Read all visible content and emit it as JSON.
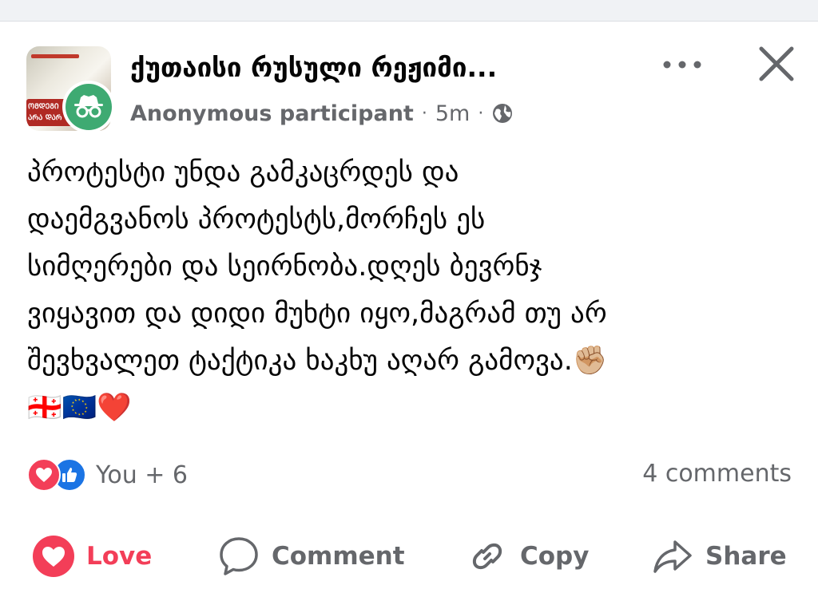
{
  "header": {
    "group_name": "ქუთაისი რუსული რეჟიმი...",
    "author": "Anonymous participant",
    "time": "5m",
    "thumb_badge_lines": [
      "ᲝᲛᲓᲔᲒᲘ",
      "ᲐᲠᲐ ᲓᲐᲠ"
    ]
  },
  "post": {
    "text": "პროტესტი უნდა გამკაცრდეს და\nდაემგვანოს პროტესტს,მორჩეს ეს\nსიმღერები და სეირნობა.დღეს ბევრნჯ\nვიყავით და დიდი მუხტი იყო,მაგრამ თუ არ\nშევხვალეთ ტაქტიკა ხაკხუ აღარ გამოვა.✊🏼\n🇬🇪🇪🇺❤️"
  },
  "reactions": {
    "count_label": "You + 6",
    "comments_label": "4 comments"
  },
  "actions": {
    "love": "Love",
    "comment": "Comment",
    "copy": "Copy",
    "share": "Share"
  },
  "colors": {
    "love": "#f33e58",
    "like": "#1b74e4",
    "anonymous_badge": "#3eaa72",
    "secondary_text": "#65676b"
  },
  "icons": [
    "anonymous-icon",
    "globe-icon",
    "more-icon",
    "close-icon",
    "love-icon",
    "like-icon",
    "comment-icon",
    "copy-link-icon",
    "share-icon"
  ]
}
